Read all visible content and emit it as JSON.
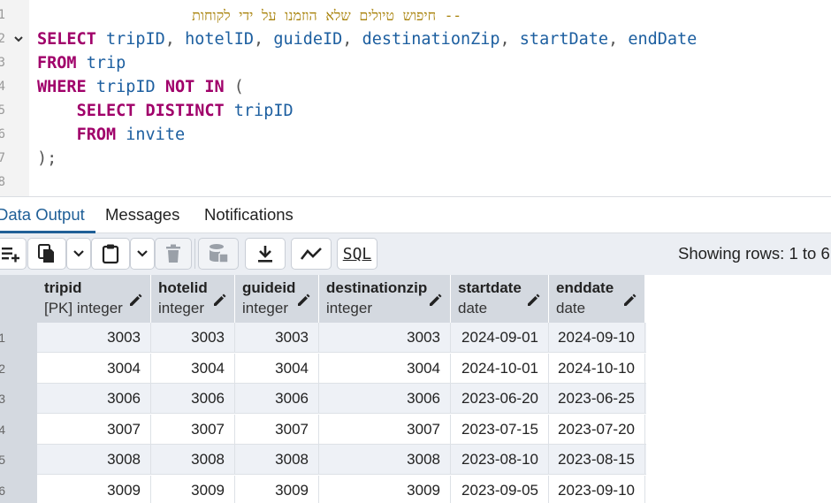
{
  "editor": {
    "line_numbers": [
      "1",
      "2",
      "3",
      "4",
      "5",
      "6",
      "7",
      "8"
    ],
    "lines": [
      [
        {
          "t": "cm",
          "v": "-- חיפוש טיולים שלא הוזמנו על ידי לקוחות"
        }
      ],
      [
        {
          "t": "kw",
          "v": "SELECT"
        },
        {
          "t": "id",
          "v": " tripID"
        },
        {
          "t": "pn",
          "v": ", "
        },
        {
          "t": "id",
          "v": "hotelID"
        },
        {
          "t": "pn",
          "v": ", "
        },
        {
          "t": "id",
          "v": "guideID"
        },
        {
          "t": "pn",
          "v": ", "
        },
        {
          "t": "id",
          "v": "destinationZip"
        },
        {
          "t": "pn",
          "v": ", "
        },
        {
          "t": "id",
          "v": "startDate"
        },
        {
          "t": "pn",
          "v": ", "
        },
        {
          "t": "id",
          "v": "endDate"
        }
      ],
      [
        {
          "t": "kw",
          "v": "FROM"
        },
        {
          "t": "id",
          "v": " trip"
        }
      ],
      [
        {
          "t": "kw",
          "v": "WHERE"
        },
        {
          "t": "id",
          "v": " tripID "
        },
        {
          "t": "kw",
          "v": "NOT IN"
        },
        {
          "t": "pn",
          "v": " ("
        }
      ],
      [
        {
          "t": "pn",
          "v": "    "
        },
        {
          "t": "kw",
          "v": "SELECT DISTINCT"
        },
        {
          "t": "id",
          "v": " tripID"
        }
      ],
      [
        {
          "t": "pn",
          "v": "    "
        },
        {
          "t": "kw",
          "v": "FROM"
        },
        {
          "t": "id",
          "v": " invite"
        }
      ],
      [
        {
          "t": "pn",
          "v": ");"
        }
      ],
      []
    ]
  },
  "tabs": [
    {
      "label": "Data Output",
      "active": true
    },
    {
      "label": "Messages",
      "active": false
    },
    {
      "label": "Notifications",
      "active": false
    }
  ],
  "toolbar": {
    "save_sql_label": "SQL",
    "status": "Showing rows: 1 to 6"
  },
  "grid": {
    "columns": [
      {
        "name": "tripid",
        "type": "[PK] integer"
      },
      {
        "name": "hotelid",
        "type": "integer"
      },
      {
        "name": "guideid",
        "type": "integer"
      },
      {
        "name": "destinationzip",
        "type": "integer"
      },
      {
        "name": "startdate",
        "type": "date"
      },
      {
        "name": "enddate",
        "type": "date"
      }
    ],
    "row_numbers": [
      "1",
      "2",
      "3",
      "4",
      "5",
      "6"
    ],
    "rows": [
      [
        "3003",
        "3003",
        "3003",
        "3003",
        "2024-09-01",
        "2024-09-10"
      ],
      [
        "3004",
        "3004",
        "3004",
        "3004",
        "2024-10-01",
        "2024-10-10"
      ],
      [
        "3006",
        "3006",
        "3006",
        "3006",
        "2023-06-20",
        "2023-06-25"
      ],
      [
        "3007",
        "3007",
        "3007",
        "3007",
        "2023-07-15",
        "2023-07-20"
      ],
      [
        "3008",
        "3008",
        "3008",
        "3008",
        "2023-08-10",
        "2023-08-15"
      ],
      [
        "3009",
        "3009",
        "3009",
        "3009",
        "2023-09-05",
        "2023-09-10"
      ]
    ]
  },
  "colors": {
    "accent": "#1f5f97",
    "keyword": "#a0006a",
    "identifier": "#1d5fa0",
    "comment": "#a8820a",
    "header_bg": "#d4d9e0",
    "row_alt_bg": "#eef1f6"
  },
  "icons": [
    "add-row-icon",
    "copy-icon",
    "chevron-down-icon",
    "paste-icon",
    "delete-icon",
    "save-data-icon",
    "download-icon",
    "graph-icon",
    "pencil-icon"
  ]
}
